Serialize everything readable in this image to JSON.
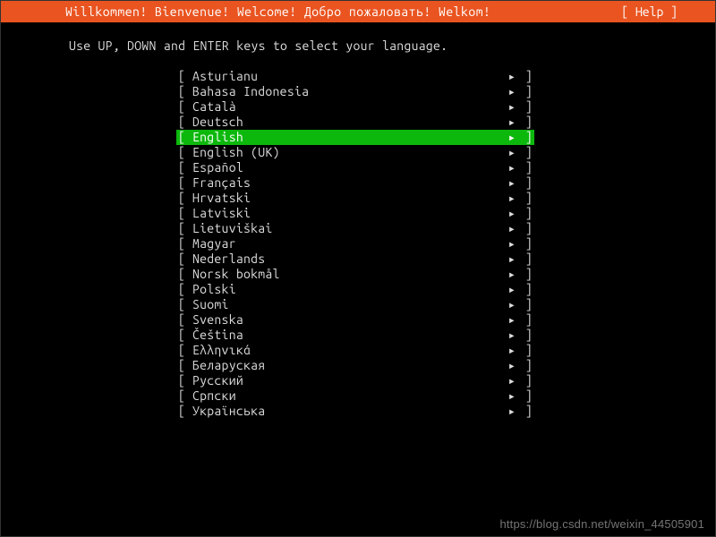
{
  "header": {
    "title": "Willkommen! Bienvenue! Welcome! Добро пожаловать! Welkom!",
    "help": "[ Help ]"
  },
  "instruction": "Use UP, DOWN and ENTER keys to select your language.",
  "bracket_left": "[",
  "bracket_right": "]",
  "arrow": "▸",
  "selected_index": 4,
  "languages": [
    "Asturianu",
    "Bahasa Indonesia",
    "Català",
    "Deutsch",
    "English",
    "English (UK)",
    "Español",
    "Français",
    "Hrvatski",
    "Latviski",
    "Lietuviškai",
    "Magyar",
    "Nederlands",
    "Norsk bokmål",
    "Polski",
    "Suomi",
    "Svenska",
    "Čeština",
    "Ελληνικά",
    "Беларуская",
    "Русский",
    "Српски",
    "Українська"
  ],
  "watermark": "https://blog.csdn.net/weixin_44505901"
}
